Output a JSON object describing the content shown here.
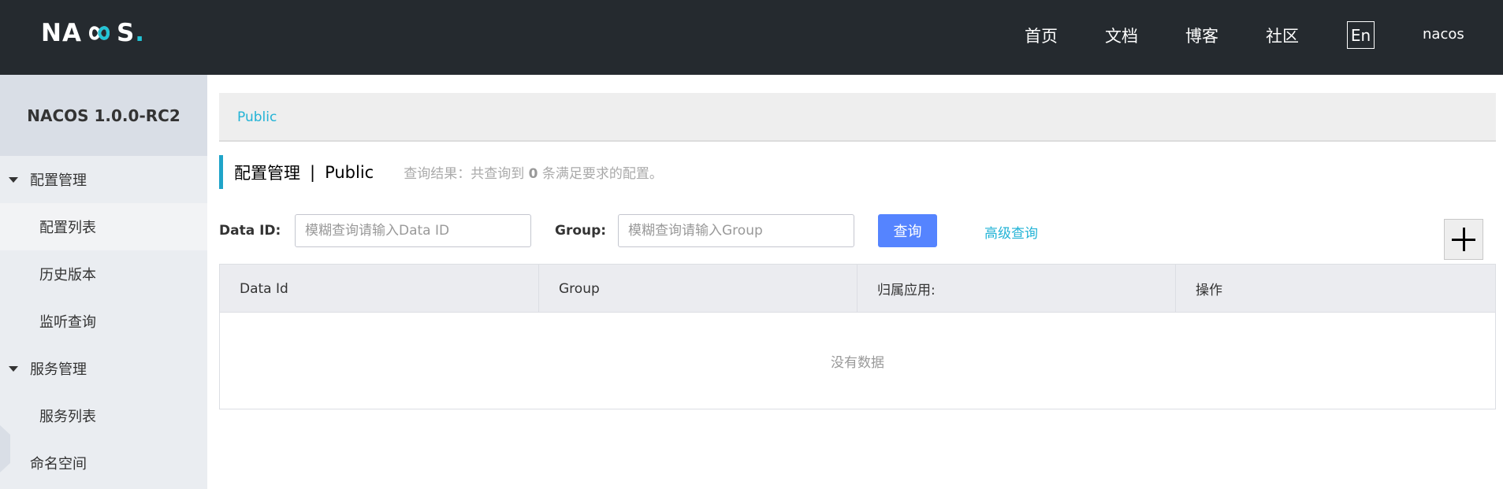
{
  "header": {
    "logo_text_a": "NA",
    "logo_text_b": "S",
    "nav": {
      "home": "首页",
      "docs": "文档",
      "blog": "博客",
      "community": "社区"
    },
    "lang_button": "En",
    "user": "nacos"
  },
  "sidebar": {
    "title": "NACOS 1.0.0-RC2",
    "config_group": "配置管理",
    "config_list": "配置列表",
    "history": "历史版本",
    "listener_query": "监听查询",
    "service_group": "服务管理",
    "service_list": "服务列表",
    "namespace": "命名空间"
  },
  "main": {
    "breadcrumb": "Public",
    "heading": "配置管理",
    "heading_sep": "|",
    "heading_namespace": "Public",
    "result_prefix": "查询结果：共查询到",
    "result_count": "0",
    "result_suffix": "条满足要求的配置。",
    "filters": {
      "dataid_label": "Data ID:",
      "dataid_placeholder": "模糊查询请输入Data ID",
      "group_label": "Group:",
      "group_placeholder": "模糊查询请输入Group",
      "query_button": "查询",
      "advanced_link": "高级查询"
    },
    "table": {
      "columns": [
        "Data Id",
        "Group",
        "归属应用:",
        "操作"
      ],
      "empty_text": "没有数据"
    }
  },
  "colors": {
    "header_bg": "#252a2f",
    "accent": "#22b3d6",
    "primary_button": "#5584ff"
  }
}
